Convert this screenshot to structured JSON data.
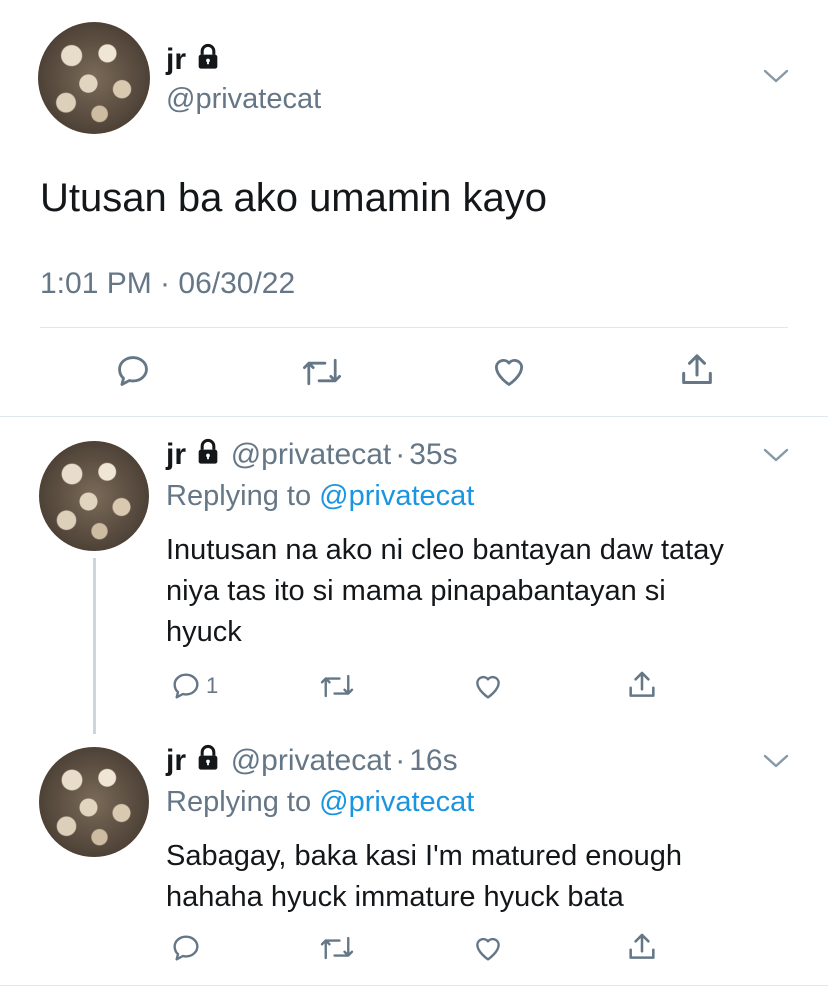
{
  "main_tweet": {
    "display_name": "jr",
    "handle": "@privatecat",
    "text": "Utusan ba ako umamin kayo",
    "timestamp": "1:01 PM · 06/30/22"
  },
  "replies": [
    {
      "display_name": "jr",
      "handle": "@privatecat",
      "separator": "·",
      "age": "35s",
      "replying_prefix": "Replying to",
      "replying_handle": "@privatecat",
      "text_lines": [
        "Inutusan na ako ni cleo bantayan daw tatay",
        "niya tas ito si mama pinapabantayan si",
        "hyuck"
      ],
      "reply_count": "1"
    },
    {
      "display_name": "jr",
      "handle": "@privatecat",
      "separator": "·",
      "age": "16s",
      "replying_prefix": "Replying to",
      "replying_handle": "@privatecat",
      "text_lines": [
        "Sabagay, baka kasi I'm matured enough",
        "hahaha hyuck immature hyuck bata"
      ],
      "reply_count": ""
    }
  ],
  "colors": {
    "text": "#14171a",
    "muted": "#657786",
    "link": "#1b95e0",
    "divider": "#e1e8ed"
  },
  "icons": [
    "lock-icon",
    "chevron-down-icon",
    "reply-icon",
    "retweet-icon",
    "like-icon",
    "share-icon"
  ]
}
